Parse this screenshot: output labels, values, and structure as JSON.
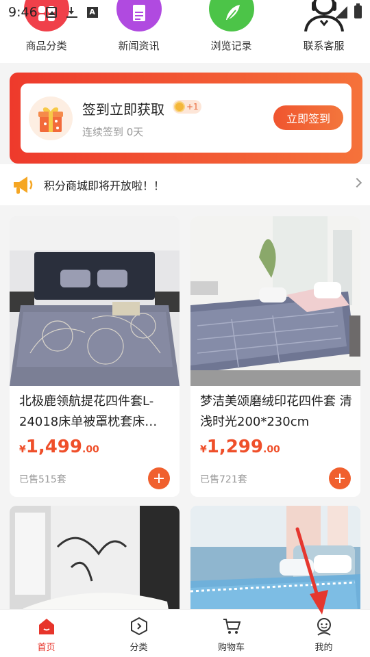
{
  "status_bar": {
    "time": "9:46"
  },
  "top_nav": [
    {
      "label": "商品分类",
      "icon": "category-icon",
      "color": "#f0404a"
    },
    {
      "label": "新闻资讯",
      "icon": "news-icon",
      "color": "#b04ae0"
    },
    {
      "label": "浏览记录",
      "icon": "history-icon",
      "color": "#4cc448"
    },
    {
      "label": "联系客服",
      "icon": "customer-service-icon",
      "color": "#222222"
    }
  ],
  "signin": {
    "title": "签到立即获取",
    "points": "+1",
    "subtitle": "连续签到 0天",
    "button": "立即签到"
  },
  "notice": {
    "text": "积分商城即将开放啦！！"
  },
  "products": [
    {
      "title": "北极鹿领航提花四件套L-24018床单被罩枕套床…",
      "currency": "¥",
      "price_int": "1,499",
      "price_dec": ".00",
      "sold": "已售515套"
    },
    {
      "title": "梦洁美颂磨绒印花四件套 清浅时光200*230cm",
      "currency": "¥",
      "price_int": "1,299",
      "price_dec": ".00",
      "sold": "已售721套"
    },
    {
      "title": "",
      "currency": "",
      "price_int": "",
      "price_dec": "",
      "sold": ""
    },
    {
      "title": "",
      "currency": "",
      "price_int": "",
      "price_dec": "",
      "sold": ""
    }
  ],
  "tabbar": [
    {
      "label": "首页",
      "icon": "home-icon",
      "active": true
    },
    {
      "label": "分类",
      "icon": "category-tab-icon",
      "active": false
    },
    {
      "label": "购物车",
      "icon": "cart-icon",
      "active": false
    },
    {
      "label": "我的",
      "icon": "profile-icon",
      "active": false
    }
  ],
  "colors": {
    "accent": "#ef4f2a",
    "active_tab": "#e7352b"
  }
}
